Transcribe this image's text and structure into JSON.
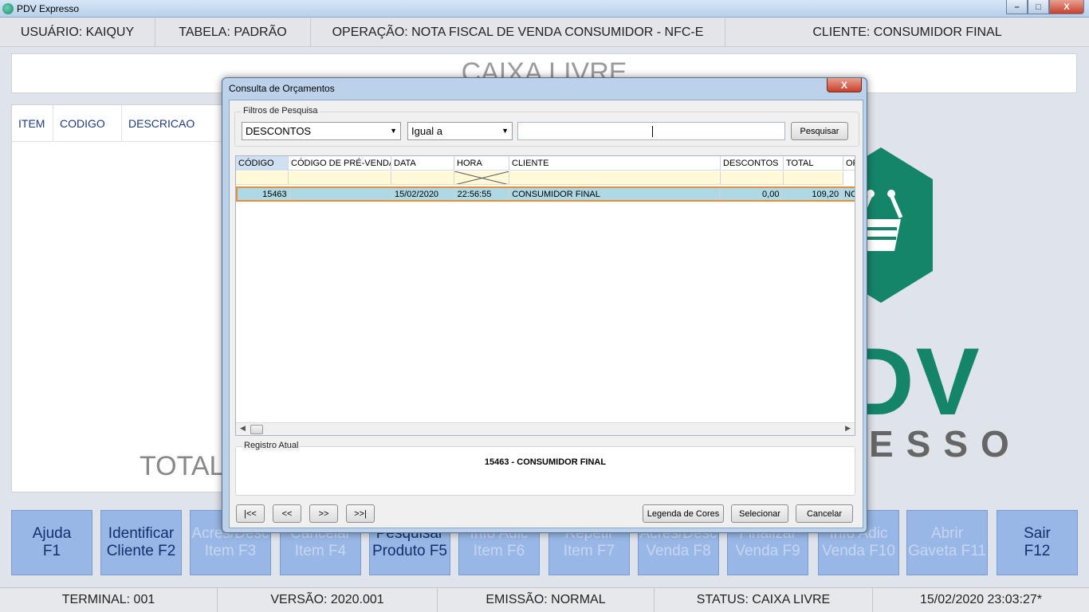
{
  "window": {
    "title": "PDV Expresso",
    "close_label": "X"
  },
  "info": {
    "usuario": "USUÁRIO: KAIQUY",
    "tabela": "TABELA: PADRÃO",
    "operacao": "OPERAÇÃO: NOTA FISCAL DE VENDA CONSUMIDOR - NFC-E",
    "cliente": "CLIENTE: CONSUMIDOR FINAL"
  },
  "caixa": "CAIXA LIVRE",
  "items_table": {
    "headers": [
      "ITEM",
      "CODIGO",
      "DESCRICAO"
    ]
  },
  "total_label": "TOTAL",
  "logo": {
    "main": "DV",
    "sub": "ESSO",
    "accent": "#158569"
  },
  "fkeys": [
    {
      "label": "Ajuda\nF1",
      "enabled": true
    },
    {
      "label": "Identificar\nCliente F2",
      "enabled": true
    },
    {
      "label": "Acres/Desc\nItem F3",
      "enabled": false
    },
    {
      "label": "Cancelar\nItem F4",
      "enabled": false
    },
    {
      "label": "Pesquisar\nProduto F5",
      "enabled": true
    },
    {
      "label": "Info Adic\nItem F6",
      "enabled": false
    },
    {
      "label": "Repetir\nItem F7",
      "enabled": false
    },
    {
      "label": "Acres/Desc\nVenda F8",
      "enabled": false
    },
    {
      "label": "Finalizar\nVenda F9",
      "enabled": false
    },
    {
      "label": "Info Adic\nVenda F10",
      "enabled": false
    },
    {
      "label": "Abrir\nGaveta F11",
      "enabled": false
    },
    {
      "label": "Sair\nF12",
      "enabled": true
    }
  ],
  "status": {
    "terminal": "TERMINAL: 001",
    "versao": "VERSÃO: 2020.001",
    "emissao": "EMISSÃO: NORMAL",
    "status": "STATUS: CAIXA LIVRE",
    "datetime": "15/02/2020 23:03:27*"
  },
  "dialog": {
    "title": "Consulta de Orçamentos",
    "close_label": "X",
    "filters_legend": "Filtros de Pesquisa",
    "field_value": "DESCONTOS",
    "operator_value": "Igual a",
    "search_value": "",
    "search_button": "Pesquisar",
    "columns": [
      "CÓDIGO",
      "CÓDIGO DE PRÉ-VENDA",
      "DATA",
      "HORA",
      "CLIENTE",
      "DESCONTOS",
      "TOTAL",
      "OP"
    ],
    "rows": [
      {
        "codigo": "15463",
        "pre_venda": "",
        "data": "15/02/2020",
        "hora": "22:56:55",
        "cliente": "CONSUMIDOR FINAL",
        "descontos": "0,00",
        "total": "109,20",
        "op": "NC"
      }
    ],
    "registro_legend": "Registro Atual",
    "registro_value": "15463 - CONSUMIDOR FINAL",
    "nav": {
      "first": "|<<",
      "prev": "<<",
      "next": ">>",
      "last": ">>|"
    },
    "legenda_button": "Legenda de Cores",
    "selecionar_button": "Selecionar",
    "cancelar_button": "Cancelar"
  }
}
